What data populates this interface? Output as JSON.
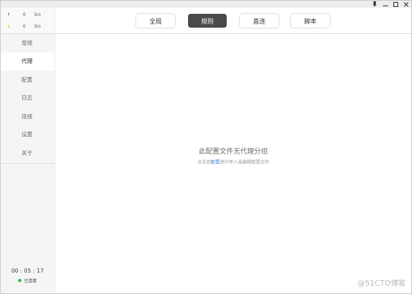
{
  "window_controls": {
    "pin_icon": "pin-icon",
    "minimize_icon": "minimize-icon",
    "maximize_icon": "maximize-icon",
    "close_icon": "close-icon"
  },
  "traffic": {
    "upload": {
      "arrow": "↑",
      "value": "0",
      "unit": "B/s"
    },
    "download": {
      "arrow": "↓",
      "value": "0",
      "unit": "B/s"
    }
  },
  "sidebar": {
    "items": [
      {
        "label": "常规"
      },
      {
        "label": "代理"
      },
      {
        "label": "配置"
      },
      {
        "label": "日志"
      },
      {
        "label": "连接"
      },
      {
        "label": "设置"
      },
      {
        "label": "关于"
      }
    ],
    "active_index": 1
  },
  "status": {
    "timer": "00 : 05 : 17",
    "connection": "已连接",
    "connection_color": "#3fb85f"
  },
  "modes": {
    "global": "全局",
    "rule": "规则",
    "direct": "直连",
    "script": "脚本",
    "active": "rule"
  },
  "empty_state": {
    "title": "此配置文件无代理分组",
    "hint_prefix": "点击到",
    "hint_link": "配置",
    "hint_suffix": "进行导入或编辑配置文件"
  },
  "watermark": "@51CTO博客",
  "colors": {
    "accent": "#3b82d6",
    "active_mode_bg": "#4a4a4a"
  }
}
